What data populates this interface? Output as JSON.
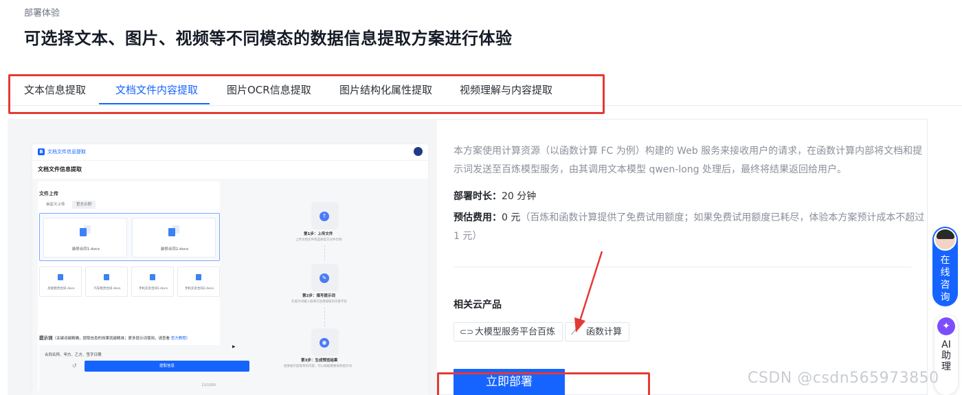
{
  "header": {
    "eyebrow": "部署体验",
    "title": "可选择文本、图片、视频等不同模态的数据信息提取方案进行体验"
  },
  "tabs": [
    {
      "label": "文本信息提取",
      "active": false
    },
    {
      "label": "文档文件内容提取",
      "active": true
    },
    {
      "label": "图片OCR信息提取",
      "active": false
    },
    {
      "label": "图片结构化属性提取",
      "active": false
    },
    {
      "label": "视频理解与内容提取",
      "active": false
    }
  ],
  "preview": {
    "app_name": "文档文件信息提取",
    "page_title": "文档文件信息提取",
    "upload_section": "文件上传",
    "upload_tabs": [
      "自定义上传",
      "官方示例"
    ],
    "main_files": [
      "装修合同1.docx",
      "装修合同2.docx"
    ],
    "small_files": [
      "房屋租赁合同.docx",
      "汽车租赁合同.docx",
      "手机买卖合同1.docx",
      "手机买卖合同2.docx"
    ],
    "prompt_label": "提示词",
    "prompt_hint": "（关键词越精确，提取信息的效果就越精准；更多提示词使用，请查看",
    "prompt_link": "官方教程",
    "prompt_hint_end": "）",
    "prompt_value": "合同名称、甲方、乙方、签字日期",
    "prompt_count": "13/1000",
    "submit_label": "提取信息",
    "steps": [
      {
        "title": "第1步：上传文件",
        "desc": "上传文档文件或选择官方文件示例"
      },
      {
        "title": "第2步：填写提示词",
        "desc": "在提示词输入框填写您想提取的内容字段"
      },
      {
        "title": "第3步：生成预览结果",
        "desc": "结果展示提取到的内容，可以根据需要修改提示词"
      }
    ]
  },
  "info": {
    "description": "本方案使用计算资源（以函数计算 FC 为例）构建的 Web 服务来接收用户的请求，在函数计算内部将文档和提示词发送至百炼模型服务，由其调用文本模型 qwen-long 处理后，最终将结果返回给用户。",
    "duration_label": "部署时长：",
    "duration_value": "20 分钟",
    "cost_label": "预估费用：",
    "cost_value": "0 元",
    "cost_note": "（百炼和函数计算提供了免费试用额度；如果免费试用额度已耗尽，体验本方案预计成本不超过 1 元）",
    "related_title": "相关云产品",
    "products": [
      {
        "label": "大模型服务平台百炼",
        "icon": "link-icon"
      },
      {
        "label": "函数计算",
        "icon": "function-icon"
      }
    ],
    "deploy_label": "立即部署"
  },
  "floating": {
    "consult_label": "在线咨询",
    "ai_label": "AI助理"
  },
  "watermark": "CSDN @csdn565973850",
  "colors": {
    "accent": "#1664ff",
    "highlight": "#e53935",
    "watermark": "#c9ccd2"
  }
}
